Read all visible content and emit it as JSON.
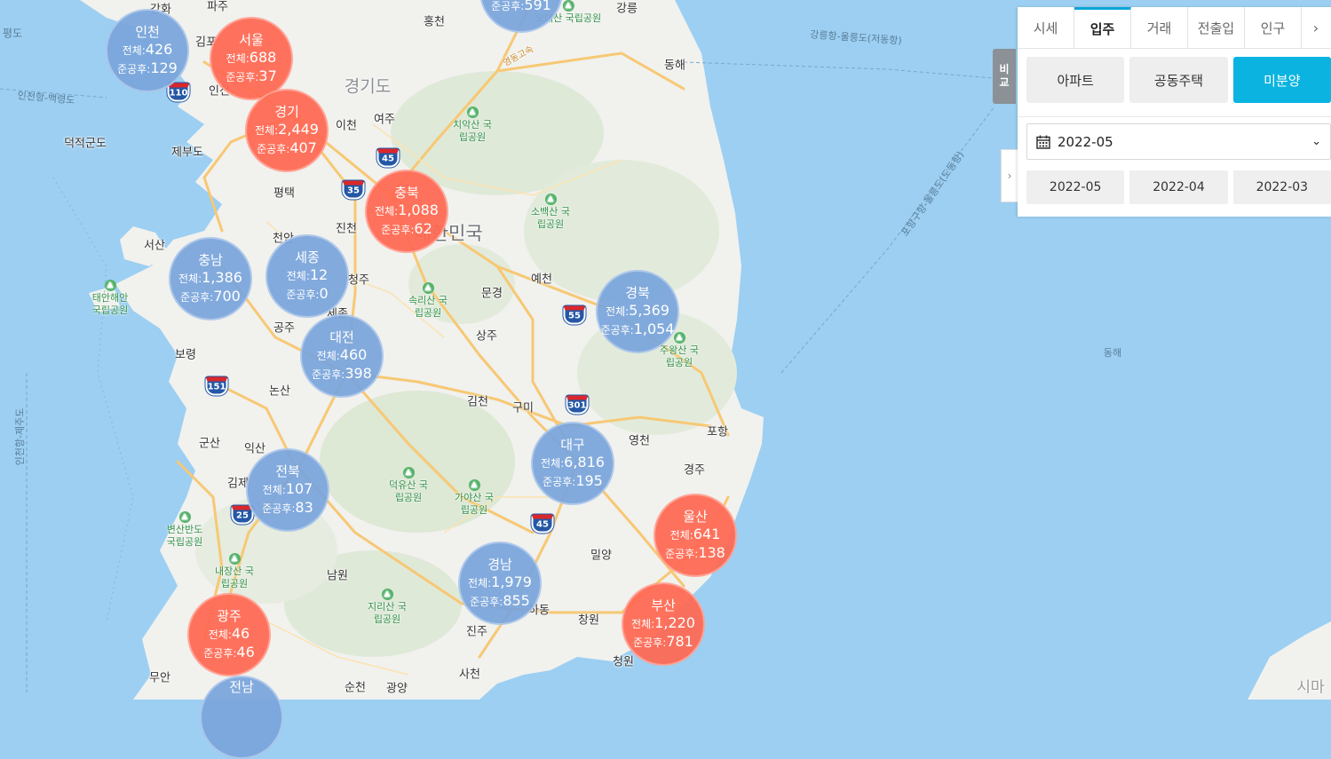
{
  "panel": {
    "tabs": [
      {
        "label": "시세",
        "active": false
      },
      {
        "label": "입주",
        "active": true
      },
      {
        "label": "거래",
        "active": false
      },
      {
        "label": "전출입",
        "active": false
      },
      {
        "label": "인구",
        "active": false
      }
    ],
    "more_icon": "chevron-right-icon",
    "types": [
      {
        "label": "아파트",
        "active": false
      },
      {
        "label": "공동주택",
        "active": false
      },
      {
        "label": "미분양",
        "active": true
      }
    ],
    "selected_month": "2022-05",
    "months": [
      "2022-05",
      "2022-04",
      "2022-03"
    ],
    "compare_label": [
      "비",
      "교"
    ],
    "collapse_icon": "chevron-right-icon"
  },
  "bubbles": [
    {
      "name": "인천",
      "total_label": "전체:",
      "total": "426",
      "after_label": "준공후:",
      "after": "129",
      "color": "blue"
    },
    {
      "name": "서울",
      "total_label": "전체:",
      "total": "688",
      "after_label": "준공후:",
      "after": "37",
      "color": "red"
    },
    {
      "name": "경기",
      "total_label": "전체:",
      "total": "2,449",
      "after_label": "준공후:",
      "after": "407",
      "color": "red"
    },
    {
      "name": "충북",
      "total_label": "전체:",
      "total": "1,088",
      "after_label": "준공후:",
      "after": "62",
      "color": "red"
    },
    {
      "name": "충남",
      "total_label": "전체:",
      "total": "1,386",
      "after_label": "준공후:",
      "after": "700",
      "color": "blue"
    },
    {
      "name": "세종",
      "total_label": "전체:",
      "total": "12",
      "after_label": "준공후:",
      "after": "0",
      "color": "blue"
    },
    {
      "name": "대전",
      "total_label": "전체:",
      "total": "460",
      "after_label": "준공후:",
      "after": "398",
      "color": "blue"
    },
    {
      "name": "경북",
      "total_label": "전체:",
      "total": "5,369",
      "after_label": "준공후:",
      "after": "1,054",
      "color": "blue"
    },
    {
      "name": "대구",
      "total_label": "전체:",
      "total": "6,816",
      "after_label": "준공후:",
      "after": "195",
      "color": "blue"
    },
    {
      "name": "전북",
      "total_label": "전체:",
      "total": "107",
      "after_label": "준공후:",
      "after": "83",
      "color": "blue"
    },
    {
      "name": "울산",
      "total_label": "전체:",
      "total": "641",
      "after_label": "준공후:",
      "after": "138",
      "color": "red"
    },
    {
      "name": "경남",
      "total_label": "전체:",
      "total": "1,979",
      "after_label": "준공후:",
      "after": "855",
      "color": "blue"
    },
    {
      "name": "부산",
      "total_label": "전체:",
      "total": "1,220",
      "after_label": "준공후:",
      "after": "781",
      "color": "red"
    },
    {
      "name": "광주",
      "total_label": "전체:",
      "total": "46",
      "after_label": "준공후:",
      "after": "46",
      "color": "red"
    },
    {
      "name": "전남",
      "total_label": "",
      "total": "",
      "after_label": "",
      "after": "",
      "color": "blue"
    },
    {
      "name": "",
      "total_label": "",
      "total": "",
      "after_label": "준공후:",
      "after": "591",
      "color": "blue"
    }
  ],
  "places": [
    "강화",
    "파주",
    "홍천",
    "강릉",
    "김포",
    "인천",
    "이천",
    "여주",
    "경기도",
    "동해",
    "제부도",
    "덕적군도",
    "평택",
    "진천",
    "천안",
    "서산",
    "청주",
    "세종",
    "공주",
    "대한민국",
    "문경",
    "예천",
    "상주",
    "보령",
    "논산",
    "김천",
    "구미",
    "포항",
    "영천",
    "경주",
    "군산",
    "익산",
    "김제",
    "남원",
    "밀양",
    "창원",
    "진주",
    "하동",
    "사천",
    "순천",
    "광양",
    "무안",
    "청원",
    "시마"
  ],
  "sea_labels": [
    "강릉항-울릉도(저동항)",
    "포항구항-울릉도(도동항)",
    "인천항-백령도",
    "인천항-제주도",
    "동해",
    "평도",
    "영동고속"
  ],
  "parks": [
    {
      "name": "오대산 국립공원"
    },
    {
      "name": "치악산 국립공원"
    },
    {
      "name": "소백산 국립공원"
    },
    {
      "name": "속리산 국립공원"
    },
    {
      "name": "태안해안 국립공원"
    },
    {
      "name": "주왕산 국립공원"
    },
    {
      "name": "덕유산 국립공원"
    },
    {
      "name": "가야산 국립공원"
    },
    {
      "name": "변산반도 국립공원"
    },
    {
      "name": "내장산 국립공원"
    },
    {
      "name": "지리산 국립공원"
    }
  ],
  "highways": [
    "110",
    "45",
    "35",
    "55",
    "151",
    "301",
    "25",
    "45"
  ]
}
